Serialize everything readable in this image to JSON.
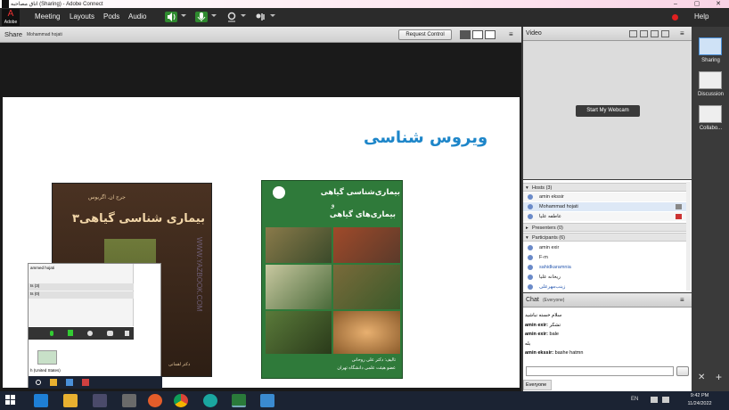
{
  "titlebar": {
    "title": "اتاق مصاحبه (Sharing) - Adobe Connect",
    "logo_label": "Adobe"
  },
  "menubar": {
    "items": [
      "Meeting",
      "Layouts",
      "Pods",
      "Audio"
    ],
    "help": "Help"
  },
  "share": {
    "title": "Share",
    "presenter": "Mohammad hojati",
    "request_control": "Request Control"
  },
  "slide": {
    "heading": "ویروس شناسی",
    "book_left": {
      "author": "جرج ان. اگریوس",
      "title": "بیماری شناسی گیاهی۳",
      "watermark": "WWW.YAZBOOK.COM",
      "credit": "دکتر لقمانی"
    },
    "book_right": {
      "title_line1": "بیماری‌شناسی گیاهی",
      "title_line2": "و",
      "title_line3": "بیماری‌های گیاهی",
      "credit_line1": "تالیف: دکتر علی روحانی",
      "credit_line2": "عضو هیئت علمی دانشگاه تهران"
    }
  },
  "overlay": {
    "name": "ammed hojati",
    "row1": "ts (3)",
    "row2": "ts (0)",
    "lang": "h (United States)"
  },
  "video": {
    "title": "Video",
    "start_webcam": "Start My Webcam"
  },
  "attendees": {
    "hosts_header": "Hosts (3)",
    "hosts": [
      "amin ekssir",
      "Mohammad hojati",
      "عاطفه علیا"
    ],
    "presenters_header": "Presenters (0)",
    "participants_header": "Participants (6)",
    "participants": [
      "amin exir",
      "F-m",
      "sahidkaramnia",
      "ریحانه علیا",
      "زینب‌مهرعلی"
    ]
  },
  "chat": {
    "title": "Chat",
    "scope": "(Everyone)",
    "messages": [
      {
        "who": "",
        "text": "سلام خسته نباشید"
      },
      {
        "who": "amin exir:",
        "text": "تشکر"
      },
      {
        "who": "amin exir:",
        "text": "bale"
      },
      {
        "who": "",
        "text": "بله"
      },
      {
        "who": "amin ekssir:",
        "text": "bashe hatmn"
      }
    ],
    "recipient": "Everyone"
  },
  "layouts": [
    {
      "label": "Sharing",
      "active": true
    },
    {
      "label": "Discussion",
      "active": false
    },
    {
      "label": "Collabo...",
      "active": false
    }
  ],
  "taskbar": {
    "lang": "EN",
    "time": "9:42 PM",
    "date": "11/24/2022"
  },
  "colors": {
    "heading_blue": "#1e86c9",
    "book_left_bg": "#3a2a1c",
    "book_right_bg": "#2f7a3a",
    "recording_red": "#e02020"
  }
}
